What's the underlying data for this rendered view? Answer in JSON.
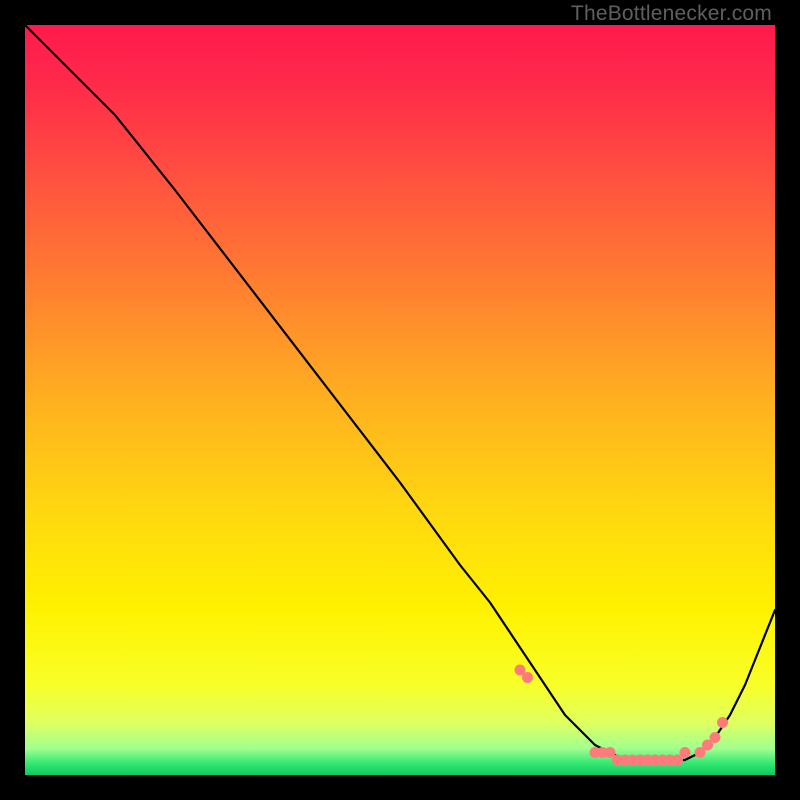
{
  "watermark": "TheBottleneсker.com",
  "gradient_stops": [
    {
      "offset": 0.0,
      "color": "#ff1a4d"
    },
    {
      "offset": 0.08,
      "color": "#ff2a4a"
    },
    {
      "offset": 0.2,
      "color": "#ff5040"
    },
    {
      "offset": 0.35,
      "color": "#ff8030"
    },
    {
      "offset": 0.5,
      "color": "#ffb020"
    },
    {
      "offset": 0.65,
      "color": "#ffd810"
    },
    {
      "offset": 0.78,
      "color": "#fff200"
    },
    {
      "offset": 0.88,
      "color": "#f8ff28"
    },
    {
      "offset": 0.93,
      "color": "#e0ff60"
    },
    {
      "offset": 0.965,
      "color": "#a0ff90"
    },
    {
      "offset": 0.985,
      "color": "#30e870"
    },
    {
      "offset": 1.0,
      "color": "#10c860"
    }
  ],
  "chart_data": {
    "type": "line",
    "title": "",
    "xlabel": "",
    "ylabel": "",
    "xlim": [
      0,
      100
    ],
    "ylim": [
      0,
      100
    ],
    "series": [
      {
        "name": "curve",
        "x": [
          0,
          8,
          12,
          20,
          30,
          40,
          50,
          58,
          62,
          66,
          68,
          70,
          72,
          74,
          76,
          78,
          80,
          82,
          84,
          86,
          88,
          90,
          92,
          94,
          96,
          98,
          100
        ],
        "y": [
          100,
          92,
          88,
          78,
          65,
          52,
          39,
          28,
          23,
          17,
          14,
          11,
          8,
          6,
          4,
          3,
          2,
          2,
          2,
          2,
          2,
          3,
          5,
          8,
          12,
          17,
          22
        ]
      }
    ],
    "markers": {
      "name": "dots",
      "color": "#ff7b7b",
      "x": [
        66,
        67,
        76,
        77,
        78,
        79,
        80,
        81,
        82,
        83,
        84,
        85,
        86,
        87,
        88,
        90,
        91,
        92,
        93
      ],
      "y": [
        14,
        13,
        3,
        3,
        3,
        2,
        2,
        2,
        2,
        2,
        2,
        2,
        2,
        2,
        3,
        3,
        4,
        5,
        7
      ]
    }
  }
}
